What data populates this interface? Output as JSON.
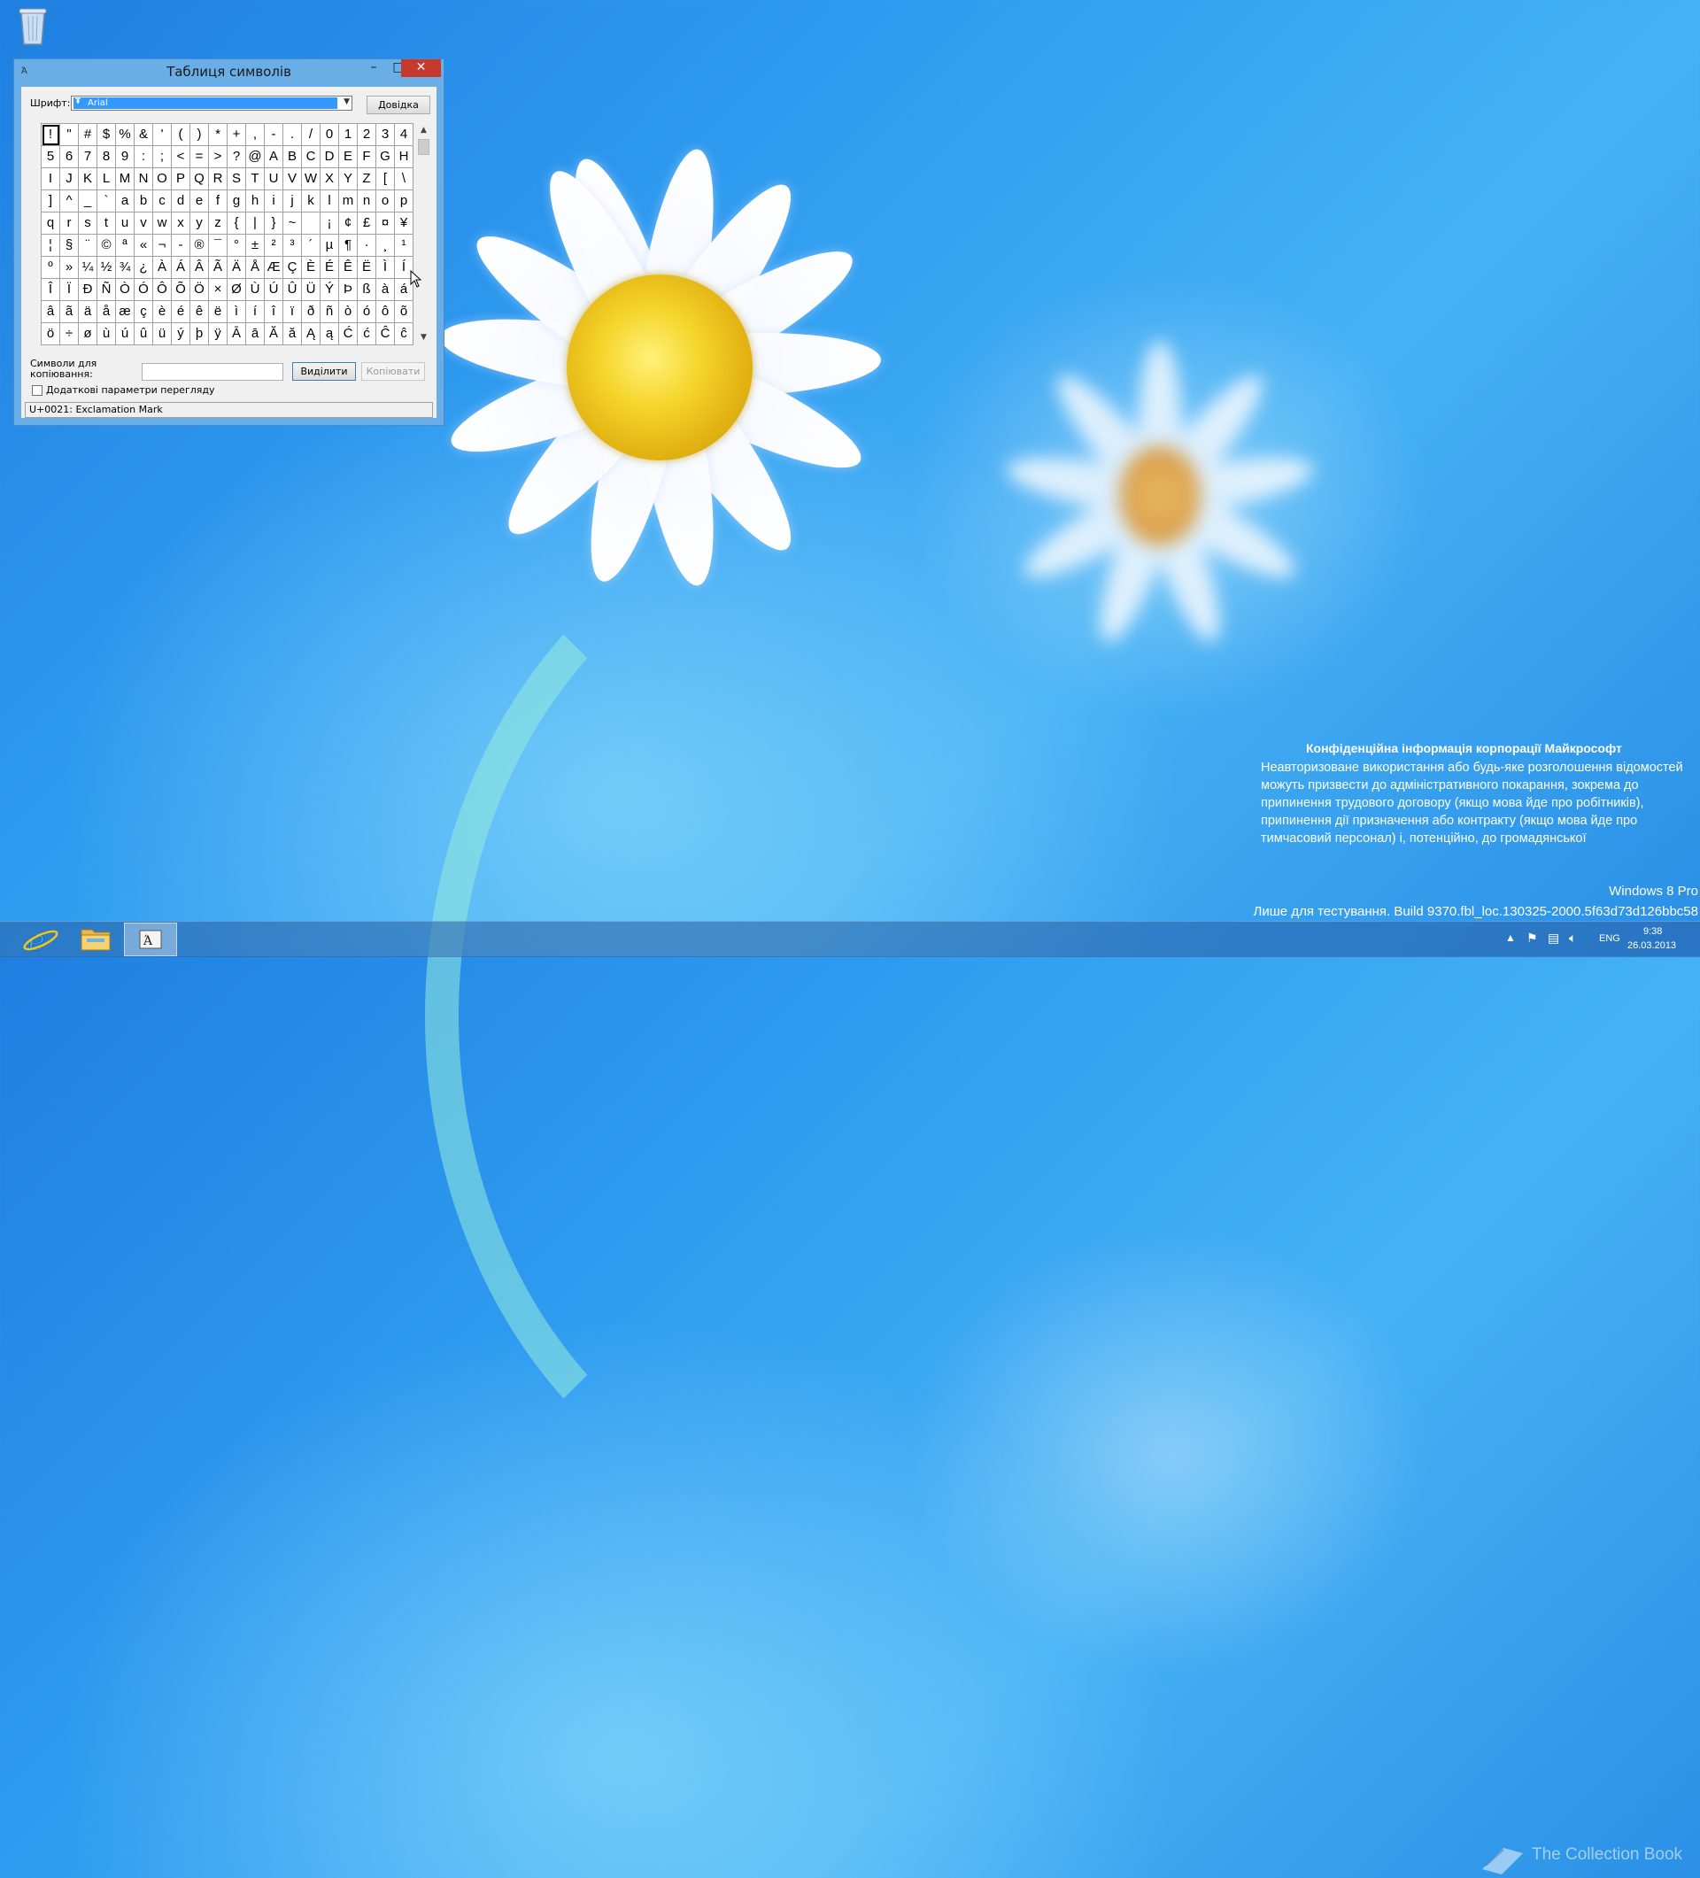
{
  "desktop": {
    "recycle_bin_label": "Кошик"
  },
  "window": {
    "title": "Таблиця символів",
    "controls": {
      "minimize": "–",
      "maximize": "□",
      "close": "✕"
    },
    "font_label": "Шрифт:",
    "font_value": "Arial",
    "help_button": "Довідка",
    "grid_rows": [
      [
        "!",
        "\"",
        "#",
        "$",
        "%",
        "&",
        "'",
        "(",
        ")",
        "*",
        "+",
        ",",
        "-",
        ".",
        "/",
        "0",
        "1",
        "2",
        "3",
        "4"
      ],
      [
        "5",
        "6",
        "7",
        "8",
        "9",
        ":",
        ";",
        "<",
        "=",
        ">",
        "?",
        "@",
        "A",
        "B",
        "C",
        "D",
        "E",
        "F",
        "G",
        "H"
      ],
      [
        "I",
        "J",
        "K",
        "L",
        "M",
        "N",
        "O",
        "P",
        "Q",
        "R",
        "S",
        "T",
        "U",
        "V",
        "W",
        "X",
        "Y",
        "Z",
        "[",
        "\\"
      ],
      [
        "]",
        "^",
        "_",
        "`",
        "a",
        "b",
        "c",
        "d",
        "e",
        "f",
        "g",
        "h",
        "i",
        "j",
        "k",
        "l",
        "m",
        "n",
        "o",
        "p"
      ],
      [
        "q",
        "r",
        "s",
        "t",
        "u",
        "v",
        "w",
        "x",
        "y",
        "z",
        "{",
        "|",
        "}",
        "~",
        " ",
        "¡",
        "¢",
        "£",
        "¤",
        "¥"
      ],
      [
        "¦",
        "§",
        "¨",
        "©",
        "ª",
        "«",
        "¬",
        "-",
        "®",
        "¯",
        "°",
        "±",
        "²",
        "³",
        "´",
        "µ",
        "¶",
        "·",
        "¸",
        "¹"
      ],
      [
        "º",
        "»",
        "¼",
        "½",
        "¾",
        "¿",
        "À",
        "Á",
        "Â",
        "Ã",
        "Ä",
        "Å",
        "Æ",
        "Ç",
        "È",
        "É",
        "Ê",
        "Ë",
        "Ì",
        "Í"
      ],
      [
        "Î",
        "Ï",
        "Ð",
        "Ñ",
        "Ò",
        "Ó",
        "Ô",
        "Õ",
        "Ö",
        "×",
        "Ø",
        "Ù",
        "Ú",
        "Û",
        "Ü",
        "Ý",
        "Þ",
        "ß",
        "à",
        "á"
      ],
      [
        "â",
        "ã",
        "ä",
        "å",
        "æ",
        "ç",
        "è",
        "é",
        "ê",
        "ë",
        "ì",
        "í",
        "î",
        "ï",
        "ð",
        "ñ",
        "ò",
        "ó",
        "ô",
        "õ"
      ],
      [
        "ö",
        "÷",
        "ø",
        "ù",
        "ú",
        "û",
        "ü",
        "ý",
        "þ",
        "ÿ",
        "Ā",
        "ā",
        "Ă",
        "ă",
        "Ą",
        "ą",
        "Ć",
        "ć",
        "Ĉ",
        "ĉ"
      ]
    ],
    "copy_label_line1": "Символи для",
    "copy_label_line2": "копіювання:",
    "copy_field_value": "",
    "select_button": "Виділити",
    "copy_button": "Копіювати",
    "advanced_view_label": "Додаткові параметри перегляду",
    "advanced_view_checked": false,
    "status_text": "U+0021: Exclamation Mark"
  },
  "watermark": {
    "confidential_title": "Конфіденційна інформація корпорації Майкрософт",
    "confidential_body": "Неавторизоване використання або будь-яке розголошення відомостей можуть призвести до адміністративного покарання, зокрема до припинення трудового договору (якщо мова йде про робітників), припинення дії призначення або контракту (якщо мова йде про тимчасовий персонал) і, потенційно, до громадянської",
    "edition": "Windows 8 Pro",
    "build": "Лише для тестування. Build 9370.fbl_loc.130325-2000.5f63d73d126bbc58"
  },
  "taskbar": {
    "apps": [
      {
        "name": "Internet Explorer",
        "icon": "internet-explorer-icon"
      },
      {
        "name": "File Explorer",
        "icon": "folder-icon"
      },
      {
        "name": "Character Map",
        "icon": "character-map-icon",
        "active": true
      }
    ],
    "tray": {
      "language": "ENG",
      "time": "9:38",
      "date": "26.03.2013"
    },
    "overlay_logo_text": "The Collection Book"
  },
  "colors": {
    "accent_selection": "#3399ff",
    "close_button": "#c7392b",
    "window_frame": "#6aaee8"
  }
}
